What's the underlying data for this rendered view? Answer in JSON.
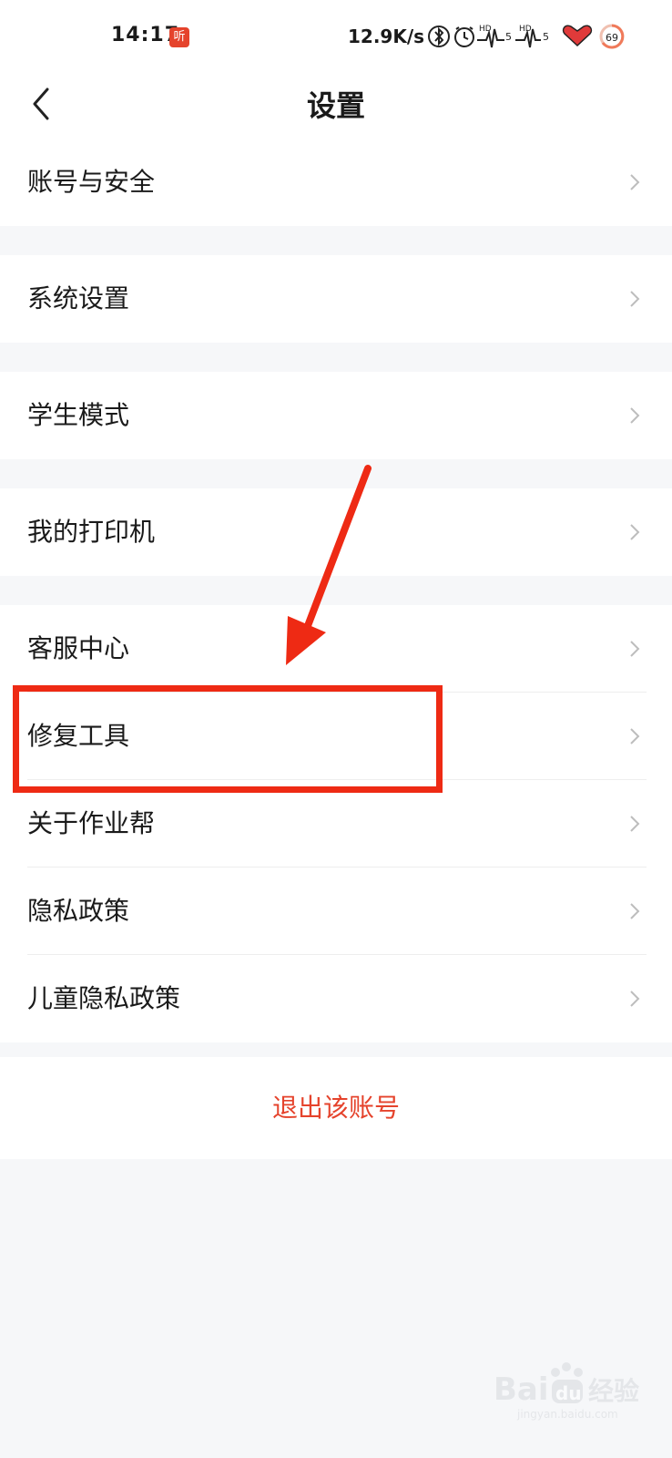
{
  "status_bar": {
    "time": "14:17",
    "app_badge": "听",
    "net_speed": "12.9K/s",
    "battery": "69",
    "icons": [
      "bluetooth-icon",
      "alarm-icon",
      "signal-hd-icon",
      "signal-hd-icon",
      "heart-icon",
      "battery-icon"
    ]
  },
  "header": {
    "title": "设置",
    "back_icon": "chevron-left-icon"
  },
  "groups": [
    {
      "items": [
        {
          "label": "账号与安全"
        }
      ]
    },
    {
      "items": [
        {
          "label": "系统设置"
        }
      ]
    },
    {
      "items": [
        {
          "label": "学生模式"
        }
      ]
    },
    {
      "items": [
        {
          "label": "我的打印机"
        }
      ]
    },
    {
      "items": [
        {
          "label": "客服中心"
        },
        {
          "label": "修复工具"
        },
        {
          "label": "关于作业帮"
        },
        {
          "label": "隐私政策"
        },
        {
          "label": "儿童隐私政策"
        }
      ]
    }
  ],
  "logout_label": "退出该账号",
  "annotation": {
    "color": "#ee2a14",
    "highlighted_item": "修复工具"
  },
  "colors": {
    "accent": "#e5432c",
    "page_bg": "#f6f7f9",
    "card_bg": "#ffffff"
  },
  "watermark": {
    "text": "Bai du 经验",
    "subtext": "jingyan.baidu.com"
  }
}
